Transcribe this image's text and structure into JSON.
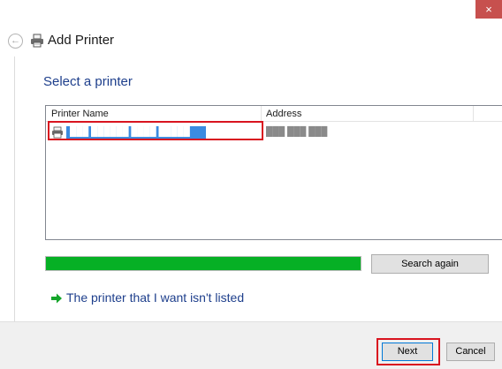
{
  "window": {
    "title": "Add Printer",
    "close_glyph": "×",
    "back_glyph": "←"
  },
  "page": {
    "heading": "Select a printer"
  },
  "printer_list": {
    "columns": [
      "Printer Name",
      "Address"
    ],
    "rows": [
      {
        "name": "███ ██████ ████ █████",
        "address": "███ ███ ███",
        "selected": true
      }
    ]
  },
  "search": {
    "progress": 1.0,
    "progress_color": "#06b025",
    "search_again_label": "Search again"
  },
  "not_listed_link": "The printer that I want isn't listed",
  "footer": {
    "next_label": "Next",
    "cancel_label": "Cancel"
  },
  "colors": {
    "accent_link": "#1e3f8c",
    "selection": "#3b8be0",
    "callout_red": "#d9141f",
    "close_red": "#c7504e"
  },
  "icons": {
    "back": "back-arrow-icon",
    "printer": "printer-icon",
    "link_arrow": "green-arrow-icon",
    "close": "close-icon"
  }
}
